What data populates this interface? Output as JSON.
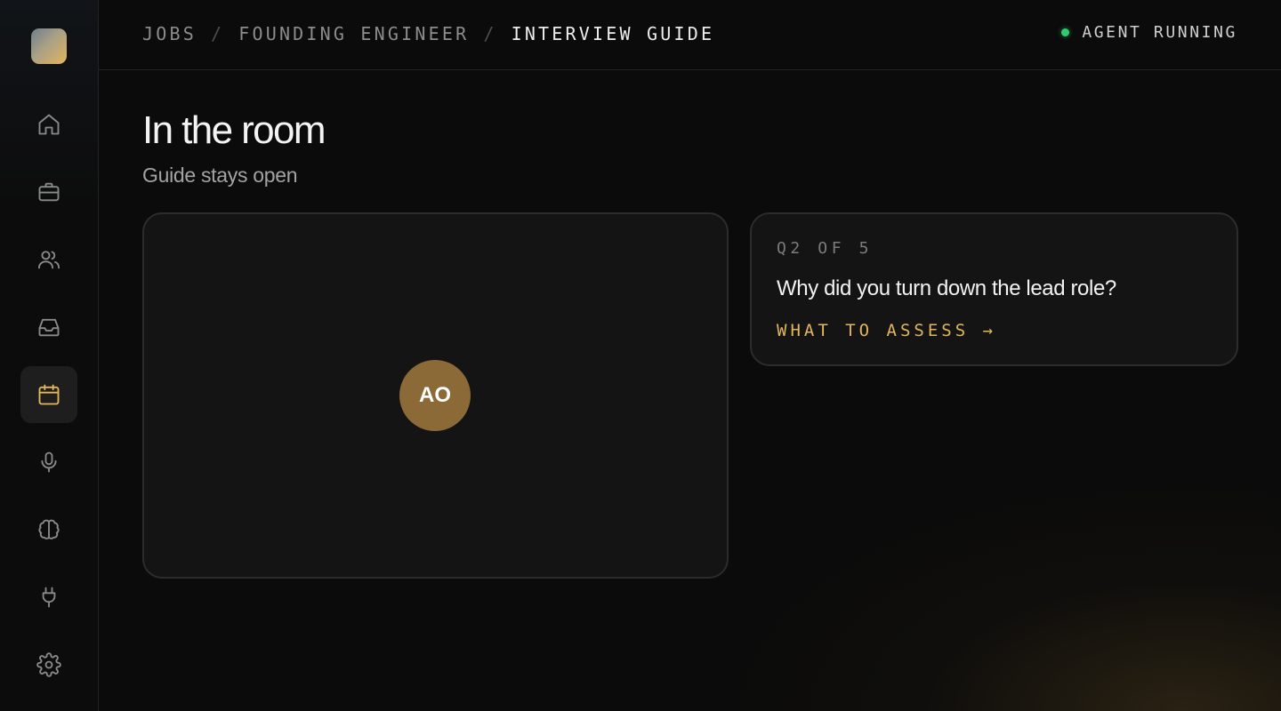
{
  "sidebar": {
    "logo": "app-logo",
    "items": [
      {
        "icon": "home-icon",
        "active": false
      },
      {
        "icon": "briefcase-icon",
        "active": false
      },
      {
        "icon": "users-icon",
        "active": false
      },
      {
        "icon": "inbox-icon",
        "active": false
      },
      {
        "icon": "calendar-icon",
        "active": true
      },
      {
        "icon": "microphone-icon",
        "active": false
      },
      {
        "icon": "brain-icon",
        "active": false
      },
      {
        "icon": "plug-icon",
        "active": false
      },
      {
        "icon": "gear-icon",
        "active": false
      }
    ]
  },
  "header": {
    "breadcrumbs": [
      "JOBS",
      "FOUNDING ENGINEER",
      "INTERVIEW GUIDE"
    ],
    "separator": "/",
    "status_label": "AGENT RUNNING",
    "status_color": "#2ecc71"
  },
  "main": {
    "title": "In the room",
    "subtitle": "Guide stays open",
    "participant": {
      "initials": "AO",
      "color": "#8b6a37"
    },
    "question": {
      "counter": "Q2 OF 5",
      "text": "Why did you turn down the lead role?",
      "assess_label": "WHAT TO ASSESS →"
    }
  },
  "colors": {
    "accent": "#e3b55c",
    "background": "#0b0b0b"
  }
}
